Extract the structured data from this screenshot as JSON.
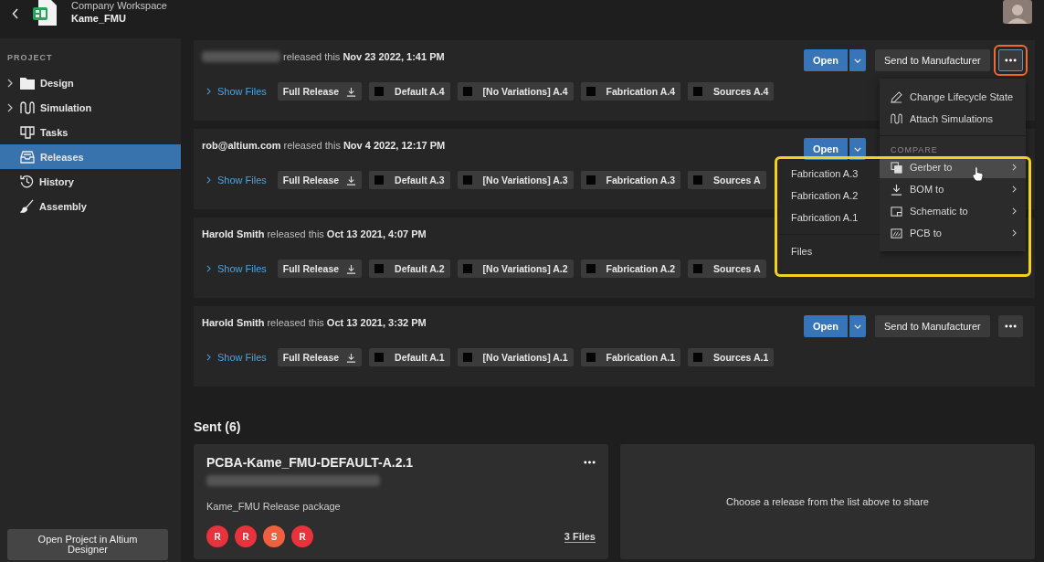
{
  "header": {
    "workspace": "Company Workspace",
    "project": "Kame_FMU"
  },
  "sidebar": {
    "section": "PROJECT",
    "items": [
      {
        "label": "Design",
        "expandable": true,
        "selected": false
      },
      {
        "label": "Simulation",
        "expandable": true,
        "selected": false
      },
      {
        "label": "Tasks",
        "expandable": false,
        "selected": false
      },
      {
        "label": "Releases",
        "expandable": false,
        "selected": true
      },
      {
        "label": "History",
        "expandable": false,
        "selected": false
      },
      {
        "label": "Assembly",
        "expandable": false,
        "selected": false
      }
    ],
    "open_button": "Open Project in Altium Designer"
  },
  "releases": [
    {
      "author_hidden": true,
      "verb": "released this",
      "date": "Nov 23 2022, 1:41 PM",
      "show_files": "Show Files",
      "files": [
        {
          "kind": "download",
          "label": "Full Release"
        },
        {
          "kind": "variant",
          "label": "Default A.4"
        },
        {
          "kind": "variant",
          "label": "[No Variations] A.4"
        },
        {
          "kind": "variant",
          "label": "Fabrication A.4"
        },
        {
          "kind": "variant",
          "label": "Sources A.4"
        }
      ],
      "actions": {
        "open": "Open",
        "send": "Send to Manufacturer",
        "more_button": {
          "highlighted": true
        }
      },
      "menu": {
        "items": [
          {
            "kind": "action",
            "label": "Change Lifecycle State",
            "selected": false
          },
          {
            "kind": "action",
            "label": "Attach Simulations",
            "selected": false
          },
          {
            "kind": "header",
            "label": "COMPARE"
          },
          {
            "kind": "compare",
            "label": "Gerber to",
            "selected": true
          },
          {
            "kind": "compare",
            "label": "BOM to",
            "selected": false
          },
          {
            "kind": "compare",
            "label": "Schematic to",
            "selected": false
          },
          {
            "kind": "compare",
            "label": "PCB to",
            "selected": false
          }
        ],
        "submenu": [
          {
            "kind": "release",
            "label": "Fabrication A.3"
          },
          {
            "kind": "release",
            "label": "Fabrication A.2"
          },
          {
            "kind": "release",
            "label": "Fabrication A.1"
          },
          {
            "kind": "files",
            "label": "Files"
          }
        ]
      }
    },
    {
      "author_hidden": false,
      "author": "rob@altium.com",
      "verb": "released this",
      "date": "Nov 4 2022, 12:17 PM",
      "show_files": "Show Files",
      "files": [
        {
          "kind": "download",
          "label": "Full Release"
        },
        {
          "kind": "variant",
          "label": "Default A.3"
        },
        {
          "kind": "variant",
          "label": "[No Variations] A.3"
        },
        {
          "kind": "variant",
          "label": "Fabrication A.3"
        },
        {
          "kind": "variant",
          "label": "Sources A"
        }
      ],
      "actions": {
        "open": "Open"
      }
    },
    {
      "author_hidden": false,
      "author": "Harold Smith",
      "verb": "released this",
      "date": "Oct 13 2021, 4:07 PM",
      "show_files": "Show Files",
      "files": [
        {
          "kind": "download",
          "label": "Full Release"
        },
        {
          "kind": "variant",
          "label": "Default A.2"
        },
        {
          "kind": "variant",
          "label": "[No Variations] A.2"
        },
        {
          "kind": "variant",
          "label": "Fabrication A.2"
        },
        {
          "kind": "variant",
          "label": "Sources A"
        }
      ]
    },
    {
      "author_hidden": false,
      "author": "Harold Smith",
      "verb": "released this",
      "date": "Oct 13 2021, 3:32 PM",
      "show_files": "Show Files",
      "files": [
        {
          "kind": "download",
          "label": "Full Release"
        },
        {
          "kind": "variant",
          "label": "Default A.1"
        },
        {
          "kind": "variant",
          "label": "[No Variations] A.1"
        },
        {
          "kind": "variant",
          "label": "Fabrication A.1"
        },
        {
          "kind": "variant",
          "label": "Sources A.1"
        }
      ],
      "actions": {
        "open": "Open",
        "send": "Send to Manufacturer",
        "more_button": {
          "highlighted": false
        }
      }
    }
  ],
  "sent": {
    "title": "Sent (6)",
    "card": {
      "title": "PCBA-Kame_FMU-DEFAULT-A.2.1",
      "description": "Kame_FMU Release package",
      "files": "3 Files",
      "avatars": [
        {
          "label": "R",
          "color": "#e8323c"
        },
        {
          "label": "R",
          "color": "#e8323c"
        },
        {
          "label": "S",
          "color": "#f0603f"
        },
        {
          "label": "R",
          "color": "#e8323c"
        }
      ]
    },
    "empty_text": "Choose a release from the list above to share"
  }
}
